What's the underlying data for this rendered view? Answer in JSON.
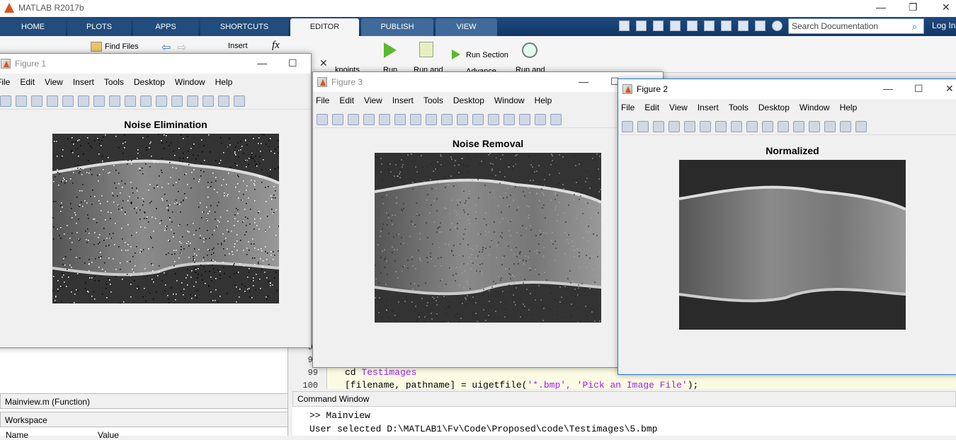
{
  "app": {
    "title": "MATLAB R2017b",
    "minimize": "—",
    "restore": "❐",
    "close": "✕"
  },
  "tabs": [
    {
      "label": "HOME"
    },
    {
      "label": "PLOTS"
    },
    {
      "label": "APPS"
    },
    {
      "label": "SHORTCUTS"
    },
    {
      "label": "EDITOR",
      "active": true
    },
    {
      "label": "PUBLISH"
    },
    {
      "label": "VIEW"
    }
  ],
  "search": {
    "placeholder": "Search Documentation"
  },
  "login": "Log In",
  "toolstrip": {
    "find_files": "Find Files",
    "insert": "Insert",
    "fx": "fx",
    "breakpoints": "kpoints",
    "run": "Run",
    "run_and_advance": "Run and",
    "run_section": "Run Section",
    "advance": "Advance",
    "run_and_time": "Run and"
  },
  "figure_menu": [
    "File",
    "Edit",
    "View",
    "Insert",
    "Tools",
    "Desktop",
    "Window",
    "Help"
  ],
  "figures": [
    {
      "name": "Figure 1",
      "plot_title": "Noise Elimination"
    },
    {
      "name": "Figure 3",
      "plot_title": "Noise Removal"
    },
    {
      "name": "Figure 2",
      "plot_title": "Normalized"
    }
  ],
  "left_panel": {
    "file_details": "Mainview.m  (Function)",
    "workspace": "Workspace",
    "col_name": "Name",
    "col_value": "Value"
  },
  "editor": {
    "lines": [
      {
        "num": "97",
        "code": ""
      },
      {
        "num": "98",
        "code": ""
      },
      {
        "num": "99",
        "code_a": "cd ",
        "code_b": "Testimages"
      },
      {
        "num": "100",
        "code_a": "[filename, pathname] = uigetfile(",
        "code_b": "'*.bmp', 'Pick an Image File'",
        "code_c": ");"
      }
    ]
  },
  "command_window": {
    "title": "Command Window",
    "lines": [
      ">> Mainview",
      "User selected D:\\MATLAB1\\Fv\\Code\\Proposed\\code\\Testimages\\5.bmp"
    ]
  },
  "colors": {
    "tab_bg": "#1e4a7e",
    "string": "#a020f0",
    "editor_bg": "#fbfbe4"
  }
}
